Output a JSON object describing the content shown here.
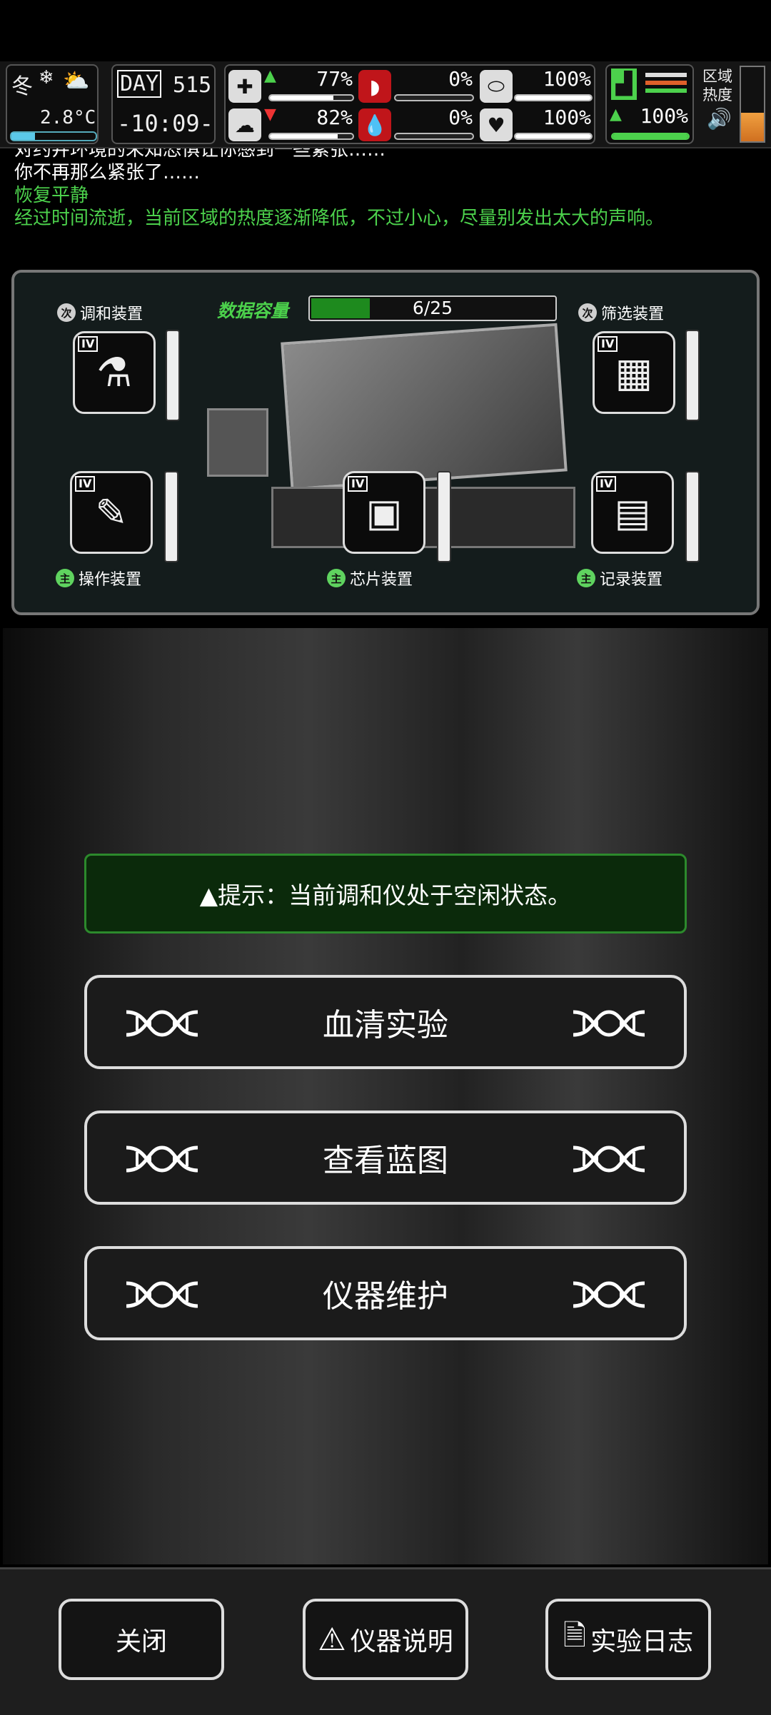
{
  "status": {
    "season": "冬",
    "temperature": "2.8°C",
    "day_label": "DAY",
    "day_number": "515",
    "clock": "-10:09-",
    "health_pct": "77%",
    "mental_pct": "82%",
    "hunger_pct": "0%",
    "blood_pct": "0%",
    "thirst_pct": "100%",
    "heart_pct": "100%",
    "stamina_pct": "100%",
    "zone_heat_label": "区域热度",
    "bars": {
      "health": 0.77,
      "mental": 0.82,
      "hunger": 0.0,
      "blood": 0.0,
      "thirst": 1.0,
      "heart": 1.0,
      "stamina": 1.0
    }
  },
  "log": {
    "lines": [
      {
        "text": "对约井环境的未知恐惧让你感到一些紧张……",
        "color": "#ffffff"
      },
      {
        "text": "你不再那么紧张了……",
        "color": "#ffffff"
      },
      {
        "text": "恢复平静",
        "color": "#4cd14c"
      },
      {
        "text": "经过时间流逝，当前区域的热度逐渐降低，不过小心，尽量别发出太大的声响。",
        "color": "#4cd14c"
      }
    ]
  },
  "lab": {
    "capacity_label": "数据容量",
    "capacity_value": "6/25",
    "capacity_fraction": 0.24,
    "devices": {
      "blend": {
        "badge": "次",
        "label": "调和装置",
        "tier": "IV"
      },
      "filter": {
        "badge": "次",
        "label": "筛选装置",
        "tier": "IV"
      },
      "operate": {
        "badge": "主",
        "label": "操作装置",
        "tier": "IV"
      },
      "chip": {
        "badge": "主",
        "label": "芯片装置",
        "tier": "IV"
      },
      "record": {
        "badge": "主",
        "label": "记录装置",
        "tier": "IV"
      }
    }
  },
  "hint": "▲提示：当前调和仪处于空闲状态。",
  "menu": [
    "血清实验",
    "查看蓝图",
    "仪器维护"
  ],
  "footer": {
    "close": "关闭",
    "manual": "仪器说明",
    "journal": "实验日志"
  },
  "colors": {
    "accent_green": "#2c8a2c",
    "text_green": "#4cd14c",
    "badge_gray": "#cfcfcf",
    "badge_green": "#5fd35f"
  }
}
